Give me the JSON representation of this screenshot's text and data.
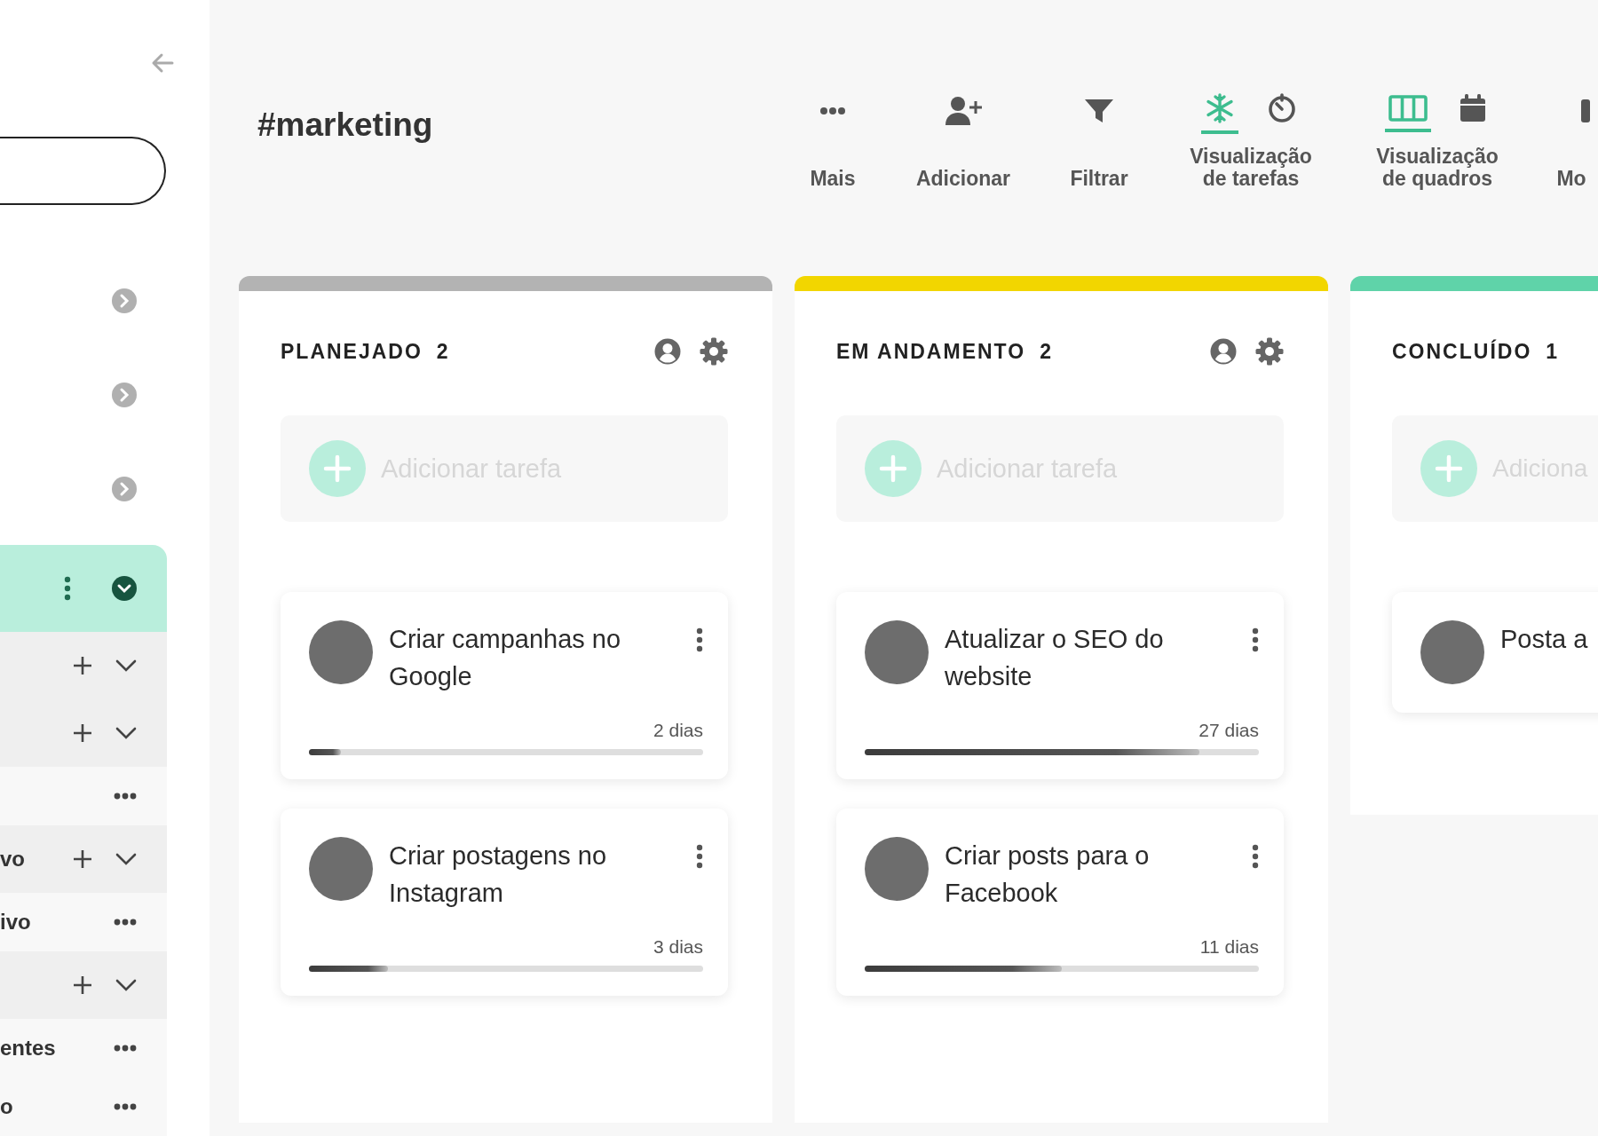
{
  "sidebar": {
    "groups": [
      {
        "selected": false,
        "expanded": false
      },
      {
        "selected": false,
        "expanded": false
      },
      {
        "selected": false,
        "expanded": false
      },
      {
        "selected": true,
        "expanded": true,
        "children": [
          {
            "kind": "add"
          },
          {
            "kind": "add"
          },
          {
            "kind": "more"
          },
          {
            "kind": "add",
            "label": "vo"
          },
          {
            "kind": "more",
            "label": "ivo"
          },
          {
            "kind": "add"
          },
          {
            "kind": "more",
            "label": "entes"
          },
          {
            "kind": "more",
            "label": "o"
          }
        ]
      }
    ]
  },
  "channel": {
    "title": "#marketing"
  },
  "toolbar": [
    {
      "kind": "more",
      "label": "Mais"
    },
    {
      "kind": "add_member",
      "label": "Adicionar"
    },
    {
      "kind": "filter",
      "label": "Filtrar"
    },
    {
      "kind": "task_views",
      "label": "Visualização de tarefas",
      "options": [
        {
          "selected": true
        },
        {
          "selected": false
        }
      ]
    },
    {
      "kind": "board_views",
      "label": "Visualização de quadros",
      "options": [
        {
          "selected": true
        },
        {
          "selected": false
        }
      ]
    },
    {
      "kind": "module",
      "label": "Mo"
    }
  ],
  "columns": [
    {
      "title": "PLANEJADO",
      "count": "2",
      "color": "#b3b3b3",
      "header_actions": true,
      "placeholder": "Adicionar tarefa",
      "tasks": [
        {
          "title": "Criar campanhas no Google",
          "duration": "2 dias",
          "level": 0.08
        },
        {
          "title": "Criar postagens no Instagram",
          "duration": "3 dias",
          "level": 0.2
        }
      ]
    },
    {
      "title": "EM ANDAMENTO",
      "count": "2",
      "color": "#f2d600",
      "header_actions": true,
      "placeholder": "Adicionar tarefa",
      "tasks": [
        {
          "title": "Atualizar o SEO do website",
          "duration": "27 dias",
          "level": 0.85
        },
        {
          "title": "Criar posts para o Facebook",
          "duration": "11 dias",
          "level": 0.5
        }
      ]
    },
    {
      "title": "CONCLUÍDO",
      "count": "1",
      "color": "#5fd3a9",
      "header_actions": false,
      "placeholder": "Adiciona",
      "tasks": [
        {
          "title": "Posta a"
        }
      ]
    }
  ]
}
